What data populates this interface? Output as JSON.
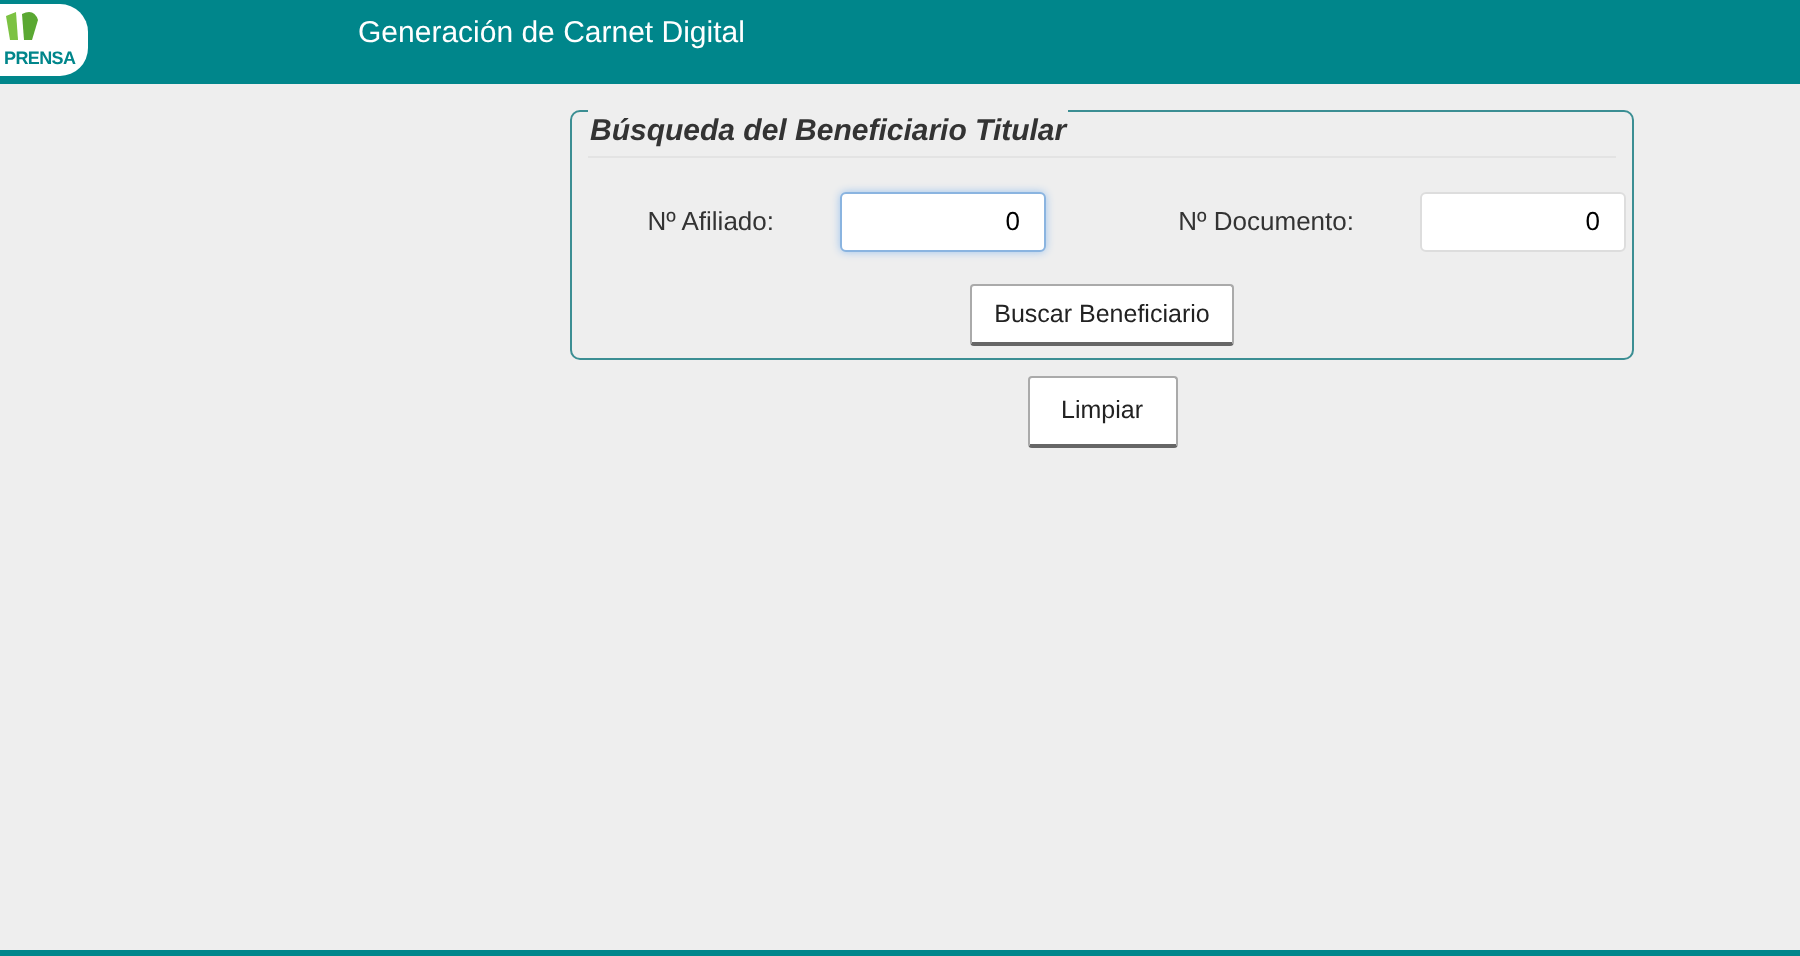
{
  "header": {
    "logo_text": "PRENSA",
    "title": "Generación de Carnet Digital"
  },
  "search_panel": {
    "legend": "Búsqueda del Beneficiario Titular",
    "fields": [
      {
        "label": "Nº Afiliado:",
        "value": "0",
        "focused": true
      },
      {
        "label": "Nº Documento:",
        "value": "0",
        "focused": false
      }
    ],
    "button": "Buscar Beneficiario"
  },
  "clear_button": "Limpiar"
}
